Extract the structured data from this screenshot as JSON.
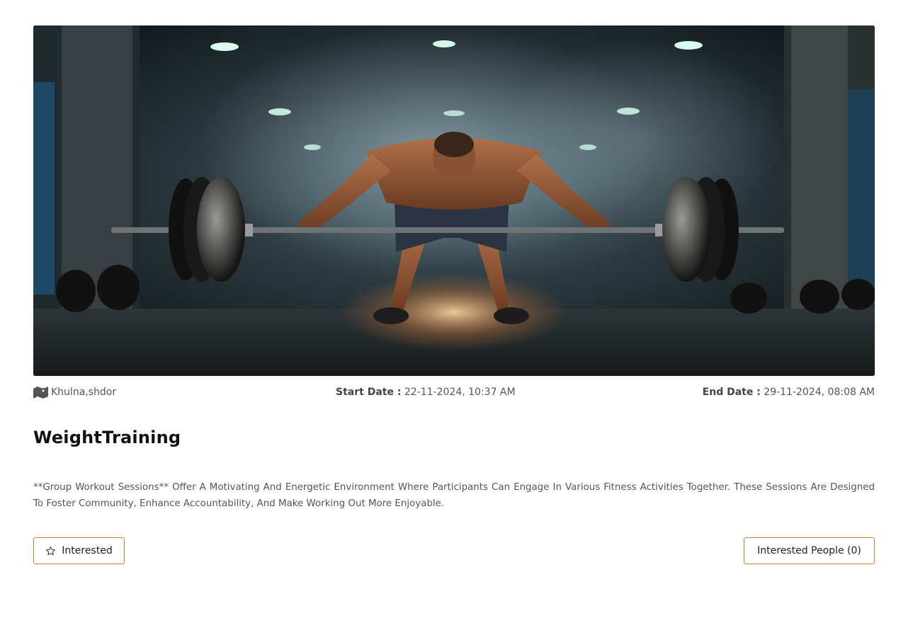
{
  "event": {
    "image": {
      "description_icon": "weightlifting-photo"
    },
    "location": {
      "icon": "map-icon",
      "text": "Khulna,shdor"
    },
    "start_date": {
      "label": "Start Date :",
      "value": "22-11-2024, 10:37 AM"
    },
    "end_date": {
      "label": "End Date :",
      "value": "29-11-2024, 08:08 AM"
    },
    "title": "WeightTraining",
    "description": "**Group Workout Sessions** Offer A Motivating And Energetic Environment Where Participants Can Engage In Various Fitness Activities Together. These Sessions Are Designed To Foster Community, Enhance Accountability, And Make Working Out More Enjoyable."
  },
  "actions": {
    "interested_label": "Interested",
    "interested_icon": "star-icon",
    "interested_people_label": "Interested People (0)"
  },
  "colors": {
    "accent_border": "#d9772f",
    "text_primary": "#111111",
    "text_secondary": "#555555"
  }
}
